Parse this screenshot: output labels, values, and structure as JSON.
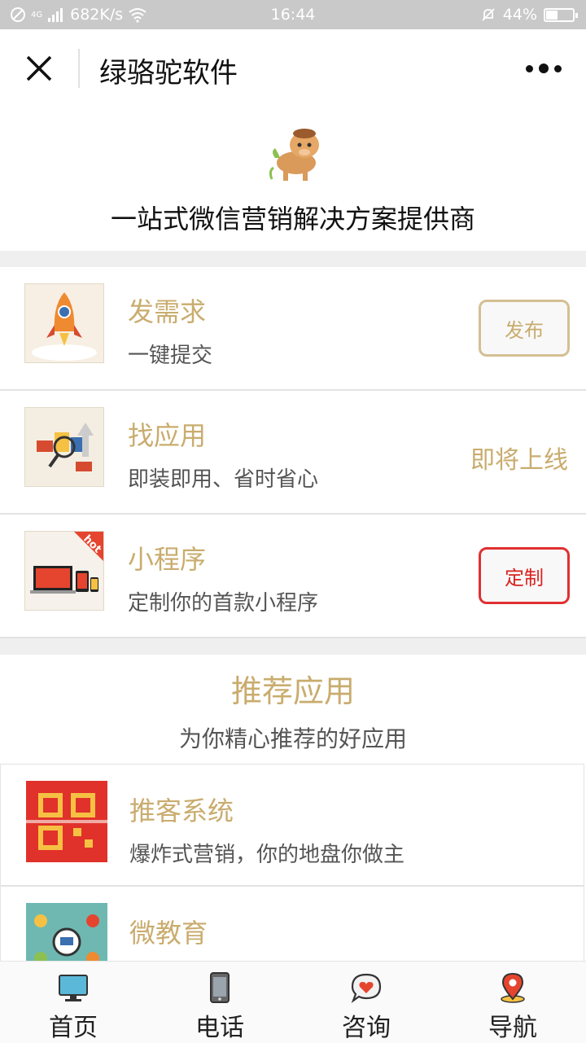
{
  "status": {
    "network": "682K/s",
    "time": "16:44",
    "battery": "44%",
    "net_tag": "4G"
  },
  "nav": {
    "title": "绿骆驼软件"
  },
  "header": {
    "slogan": "一站式微信营销解决方案提供商"
  },
  "features": [
    {
      "title": "发需求",
      "subtitle": "一键提交",
      "action": "发布"
    },
    {
      "title": "找应用",
      "subtitle": "即装即用、省时省心",
      "action": "即将上线"
    },
    {
      "title": "小程序",
      "subtitle": "定制你的首款小程序",
      "action": "定制",
      "badge": "hot"
    }
  ],
  "recommend": {
    "title": "推荐应用",
    "subtitle": "为你精心推荐的好应用",
    "items": [
      {
        "title": "推客系统",
        "subtitle": "爆炸式营销，你的地盘你做主"
      },
      {
        "title": "微教育"
      }
    ]
  },
  "tabs": [
    {
      "label": "首页",
      "icon": "monitor-icon"
    },
    {
      "label": "电话",
      "icon": "phone-icon"
    },
    {
      "label": "咨询",
      "icon": "chat-heart-icon"
    },
    {
      "label": "导航",
      "icon": "map-pin-icon"
    }
  ],
  "colors": {
    "gold": "#c9ac6e",
    "red": "#d9221f",
    "gap": "#efefef"
  }
}
